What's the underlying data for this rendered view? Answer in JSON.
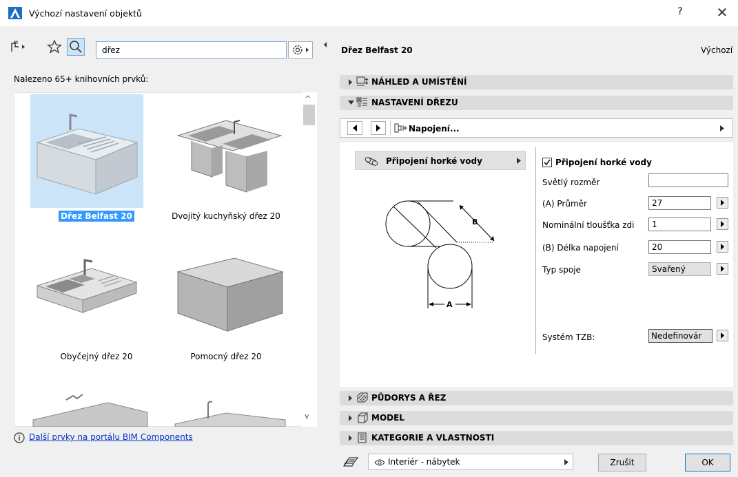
{
  "window": {
    "title": "Výchozí nastavení objektů",
    "help": "?",
    "close": "✕"
  },
  "search": {
    "value": "dřez",
    "placeholder": ""
  },
  "found_label": "Nalezeno 65+ knihovních prvků:",
  "library_items": [
    {
      "label": "Dřez Belfast 20",
      "selected": true
    },
    {
      "label": "Dvojitý kuchyňský dřez 20"
    },
    {
      "label": "Obyčejný dřez 20"
    },
    {
      "label": "Pomocný dřez 20"
    }
  ],
  "more_link": "Další prvky na portálu BIM Components",
  "object_name": "Dřez Belfast 20",
  "default_label": "Výchozí",
  "sections": {
    "preview": "NÁHLED A UMÍSTĚNÍ",
    "sink_settings": "NASTAVENÍ DŘEZU",
    "floorplan": "PŮDORYS A ŘEZ",
    "model": "MODEL",
    "category": "KATEGORIE A VLASTNOSTI"
  },
  "nav": {
    "panel_label": "Napojení..."
  },
  "hot_water_dropdown": "Připojení horké vody",
  "diagram": {
    "label_a": "A",
    "label_b": "B"
  },
  "params": {
    "checkbox_label": "Připojení horké vody",
    "clear_size": {
      "label": "Světlý rozměr",
      "value": ""
    },
    "diameter": {
      "label": "(A) Průměr",
      "value": "27"
    },
    "wall_thickness": {
      "label": "Nominální tloušťka zdi",
      "value": "1"
    },
    "connection_length": {
      "label": "(B) Délka napojení",
      "value": "20"
    },
    "joint_type": {
      "label": "Typ spoje",
      "value": "Svařený"
    },
    "mep_system": {
      "label": "Systém TZB:",
      "value": "Nedefinovár"
    }
  },
  "bottom": {
    "favorite": "Interiér - nábytek",
    "cancel": "Zrušit",
    "ok": "OK"
  },
  "colors": {
    "accent": "#3399ff",
    "selection_bg": "#cce4f7",
    "link": "#0033cc"
  }
}
